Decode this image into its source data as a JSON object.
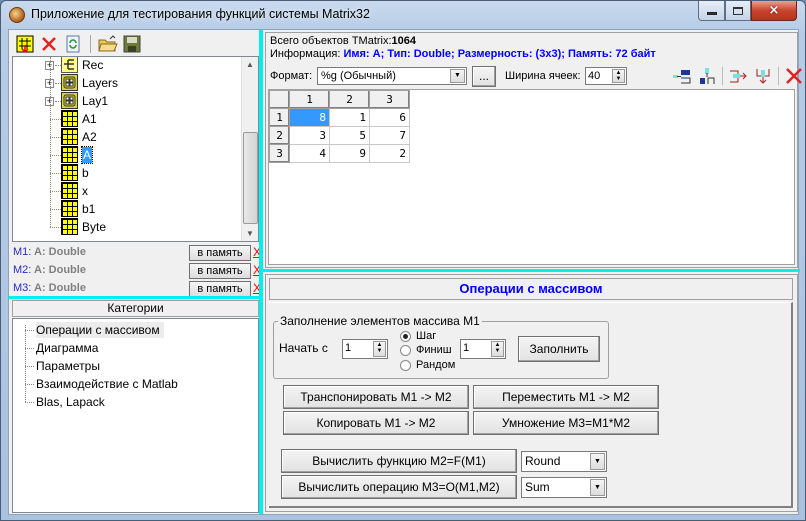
{
  "window": {
    "title": "Приложение для тестирования функций системы Matrix32",
    "controls": {
      "minimize": "minimize-icon",
      "maximize": "maximize-icon",
      "close": "×"
    }
  },
  "toolbar": {
    "icons": [
      "new-matrix-icon",
      "delete-icon",
      "refresh-icon",
      "open-folder-icon",
      "save-icon"
    ]
  },
  "tree": {
    "items": [
      {
        "label": "Rec",
        "icon": "record-icon",
        "expandable": true
      },
      {
        "label": "Layers",
        "icon": "layers-icon",
        "expandable": true
      },
      {
        "label": "Lay1",
        "icon": "layers-icon",
        "expandable": true
      },
      {
        "label": "A1",
        "icon": "matrix-icon",
        "expandable": false
      },
      {
        "label": "A2",
        "icon": "matrix-icon",
        "expandable": false
      },
      {
        "label": "A",
        "icon": "matrix-icon",
        "expandable": false,
        "selected": true
      },
      {
        "label": "b",
        "icon": "matrix-icon",
        "expandable": false
      },
      {
        "label": "x",
        "icon": "matrix-icon",
        "expandable": false
      },
      {
        "label": "b1",
        "icon": "matrix-icon",
        "expandable": false
      },
      {
        "label": "Byte",
        "icon": "matrix-icon",
        "expandable": false
      }
    ]
  },
  "memory_slots": [
    {
      "key": "M1:",
      "value": "A: Double",
      "button": "в память",
      "clear": "X"
    },
    {
      "key": "M2:",
      "value": "A: Double",
      "button": "в память",
      "clear": "X"
    },
    {
      "key": "M3:",
      "value": "A: Double",
      "button": "в память",
      "clear": "X"
    }
  ],
  "categories": {
    "header": "Категории",
    "items": [
      "Операции с массивом",
      "Диаграмма",
      "Параметры",
      "Взаимодействие с Matlab",
      "Blas, Lapack"
    ],
    "selected_index": 0
  },
  "info": {
    "total_label": "Всего объектов TMatrix:",
    "total_value": "1064",
    "info_label": "Информация:",
    "info_value": "Имя: A; Тип: Double; Размерность: (3x3); Память: 72 байт"
  },
  "format": {
    "label": "Формат:",
    "value": "%g (Обычный)",
    "ellipsis_button": "...",
    "cell_width_label": "Ширина ячеек:",
    "cell_width_value": "40",
    "tool_icons": [
      "insert-column-icon",
      "insert-row-icon",
      "append-column-icon",
      "append-row-icon",
      "delete-icon"
    ]
  },
  "matrix": {
    "col_headers": [
      "1",
      "2",
      "3"
    ],
    "row_headers": [
      "1",
      "2",
      "3"
    ],
    "rows": [
      [
        "8",
        "1",
        "6"
      ],
      [
        "3",
        "5",
        "7"
      ],
      [
        "4",
        "9",
        "2"
      ]
    ],
    "selected": [
      0,
      0
    ]
  },
  "operations": {
    "title": "Операции с массивом",
    "fill_group": {
      "title": "Заполнение элементов массива M1",
      "start_label": "Начать с",
      "start_value": "1",
      "radio_options": [
        "Шаг",
        "Финиш",
        "Рандом"
      ],
      "radio_selected": 0,
      "step_value": "1",
      "fill_button": "Заполнить"
    },
    "transpose_button": "Транспонировать M1 -> M2",
    "move_button": "Переместить M1 -> M2",
    "copy_button": "Копировать M1 -> M2",
    "multiply_button": "Умножение M3=M1*M2",
    "calc_function_button": "Вычислить функцию M2=F(M1)",
    "function_value": "Round",
    "calc_operation_button": "Вычислить операцию M3=O(M1,M2)",
    "operation_value": "Sum"
  },
  "colors": {
    "splitter": "#00f0f0",
    "accent_blue": "#0000ff",
    "selection": "#3399ff",
    "clear_red": "#ff0000"
  }
}
